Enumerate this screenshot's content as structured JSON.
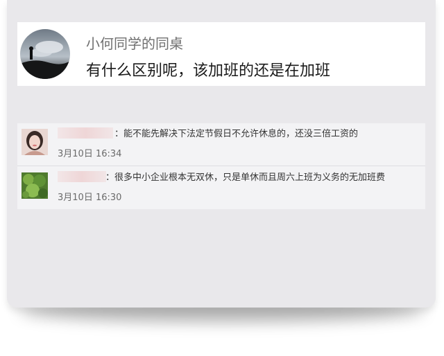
{
  "post": {
    "author": "小何同学的同桌",
    "text": "有什么区别呢，该加班的还是在加班"
  },
  "comments": [
    {
      "text": "：能不能先解决下法定节假日不允许休息的，还没三倍工资的",
      "time": "3月10日 16:34",
      "avatar": "woman-portrait"
    },
    {
      "text": "：很多中小企业根本无双休，只是单休而且周六上班为义务的无加班费",
      "time": "3月10日 16:30",
      "avatar": "green-plant"
    }
  ],
  "colors": {
    "card_bg": "#e9e8eb",
    "post_bg": "#ffffff",
    "comment_bg": "#f3f3f5",
    "author_text": "#6f6f6f",
    "body_text": "#1a1a1a"
  }
}
